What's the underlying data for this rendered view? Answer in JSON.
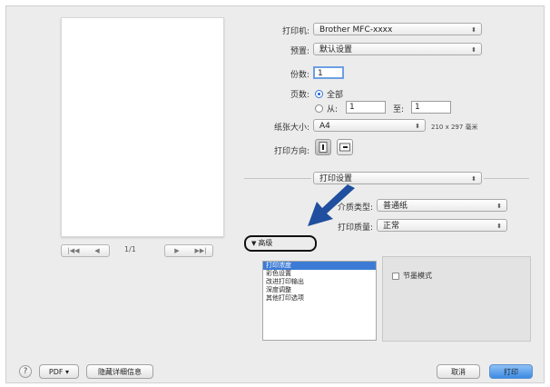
{
  "printer": {
    "label": "打印机:",
    "value": "Brother MFC-xxxx"
  },
  "presets": {
    "label": "预置:",
    "value": "默认设置"
  },
  "copies": {
    "label": "份数:",
    "value": "1"
  },
  "pages": {
    "label": "页数:",
    "all_label": "全部",
    "from_label": "从:",
    "from_value": "1",
    "to_label": "至:",
    "to_value": "1"
  },
  "paper_size": {
    "label": "纸张大小:",
    "value": "A4",
    "dimensions": "210 x 297 毫米"
  },
  "orientation": {
    "label": "打印方向:"
  },
  "section_popup": {
    "value": "打印设置"
  },
  "media_type": {
    "label": "介质类型:",
    "value": "普通纸"
  },
  "print_quality": {
    "label": "打印质量:",
    "value": "正常"
  },
  "advanced": {
    "label": "高级"
  },
  "advanced_list": [
    "打印浓度",
    "彩色设置",
    "改进打印输出",
    "深度调整",
    "其他打印选项"
  ],
  "option_panel": {
    "checkbox_label": "节墨模式"
  },
  "preview": {
    "page_indicator": "1/1",
    "first_label": "|◀◀",
    "prev_label": "◀",
    "next_label": "▶",
    "last_label": "▶▶|"
  },
  "footer": {
    "help_label": "?",
    "pdf_label": "PDF ▾",
    "hide_details_label": "隐藏详细信息",
    "cancel_label": "取消",
    "print_label": "打印"
  },
  "colors": {
    "accent": "#3b7bd6",
    "arrow": "#1f4f9e"
  }
}
